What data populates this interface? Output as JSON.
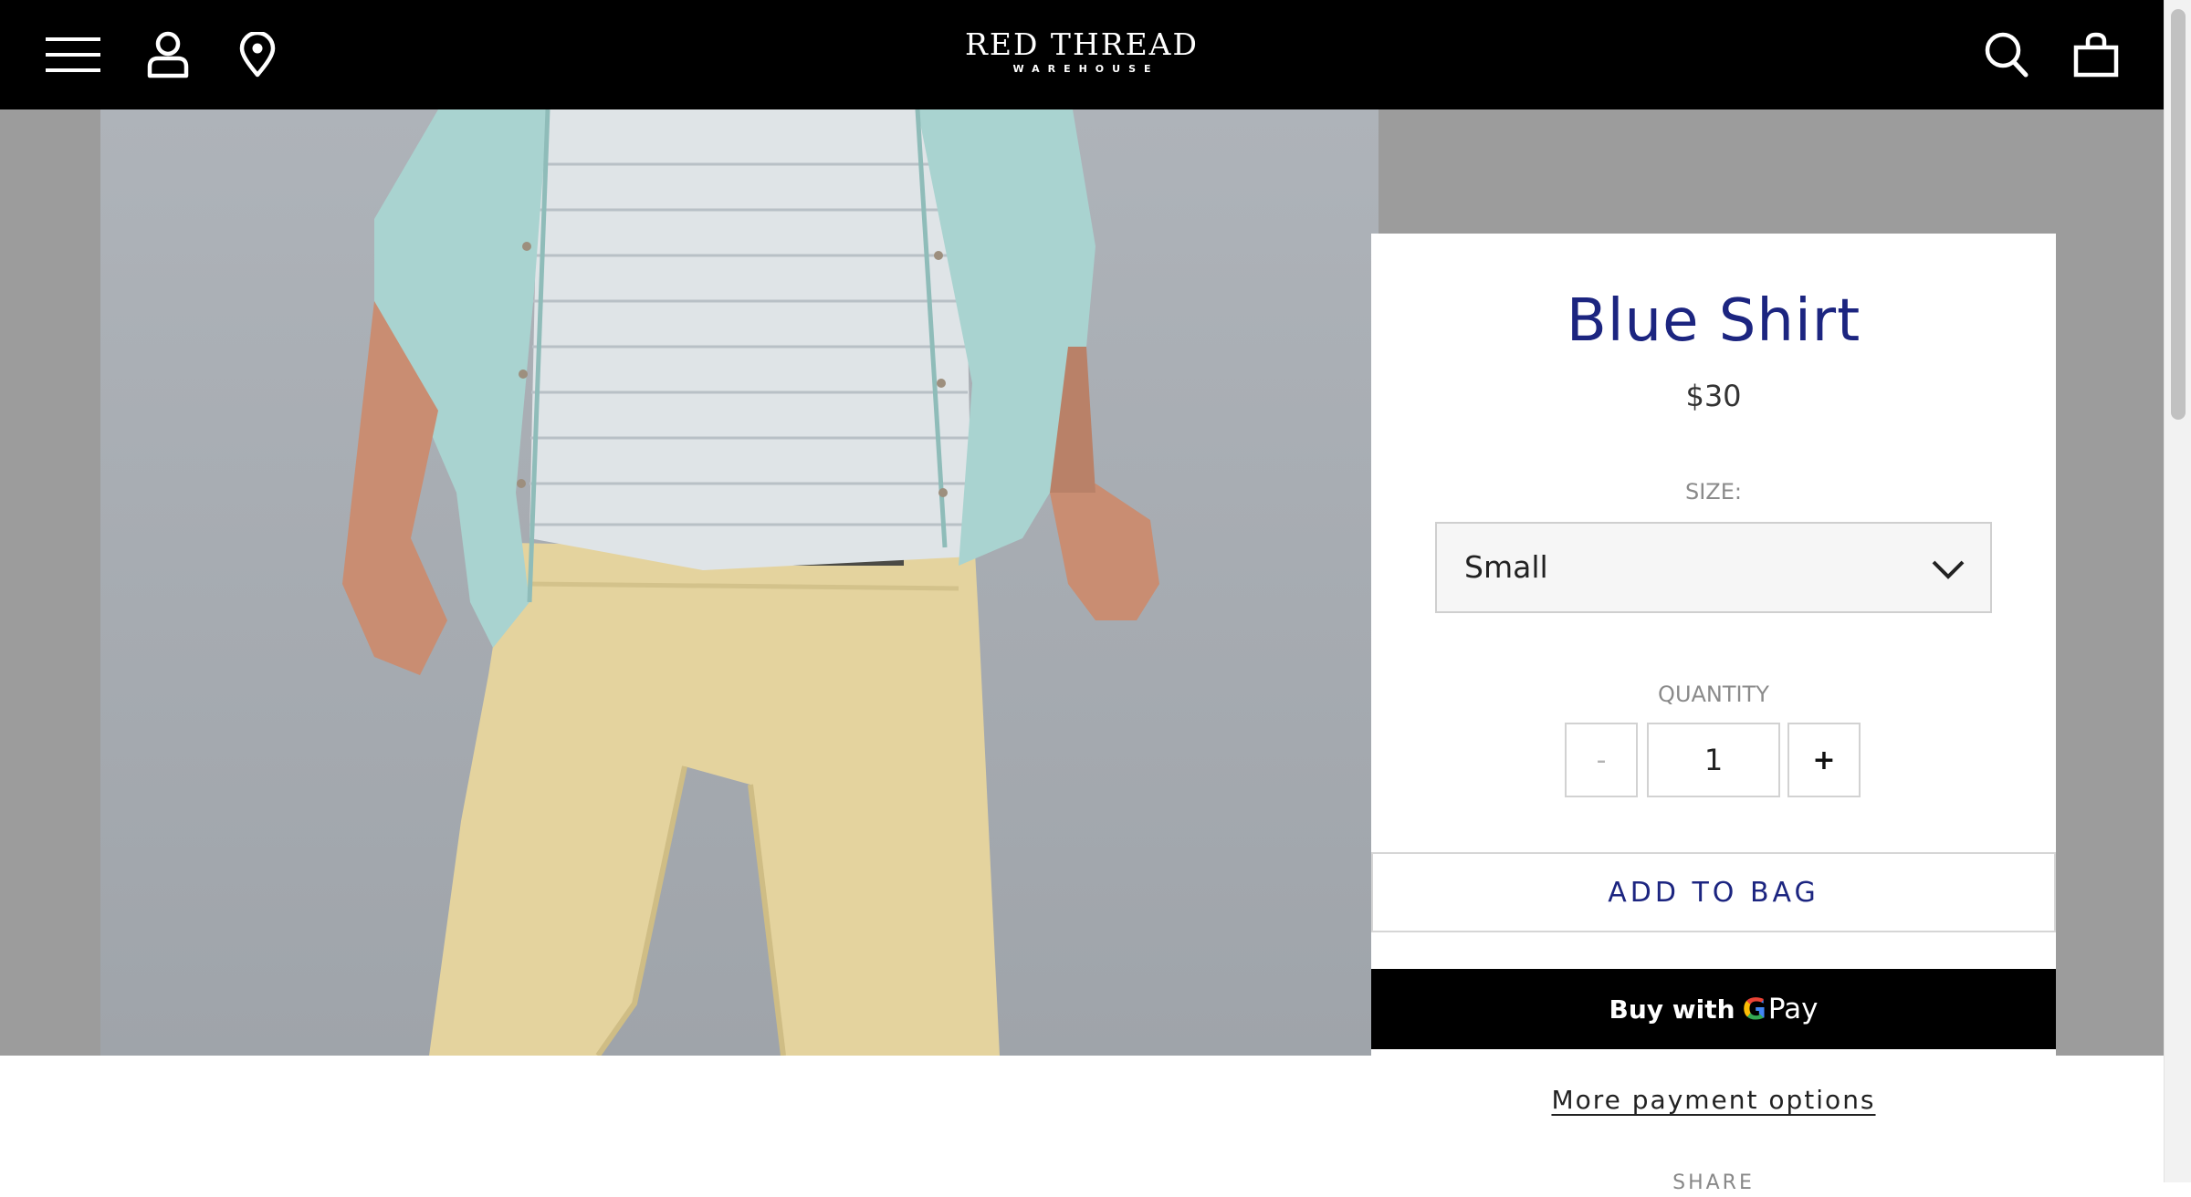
{
  "header": {
    "brand_main": "RED THREAD",
    "brand_sub": "WAREHOUSE",
    "icons": [
      "menu-icon",
      "account-icon",
      "location-icon",
      "search-icon",
      "bag-icon"
    ]
  },
  "product": {
    "title": "Blue Shirt",
    "price": "$30",
    "size_label": "SIZE:",
    "size_value": "Small",
    "quantity_label": "QUANTITY",
    "quantity_value": "1",
    "qty_minus": "-",
    "qty_plus": "+",
    "add_to_bag": "ADD TO BAG",
    "gpay_buy_with": "Buy with",
    "gpay_g": "G",
    "gpay_pay": "Pay",
    "more_payment": "More payment options",
    "share_label": "SHARE"
  },
  "colors": {
    "header_bg": "#000000",
    "accent_navy": "#1c2580",
    "hero_bg": "#9c9c9c",
    "gpay_bg": "#000000"
  }
}
